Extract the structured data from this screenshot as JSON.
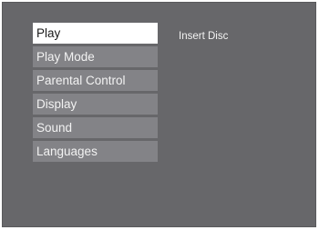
{
  "menu": {
    "items": [
      {
        "label": "Play",
        "selected": true
      },
      {
        "label": "Play Mode",
        "selected": false
      },
      {
        "label": "Parental Control",
        "selected": false
      },
      {
        "label": "Display",
        "selected": false
      },
      {
        "label": "Sound",
        "selected": false
      },
      {
        "label": "Languages",
        "selected": false
      }
    ]
  },
  "status": {
    "message": "Insert Disc"
  },
  "colors": {
    "background": "#67676a",
    "item_background": "#838387",
    "selected_background": "#ffffff",
    "text": "#f2f2f2",
    "selected_text": "#1a1a1a"
  }
}
